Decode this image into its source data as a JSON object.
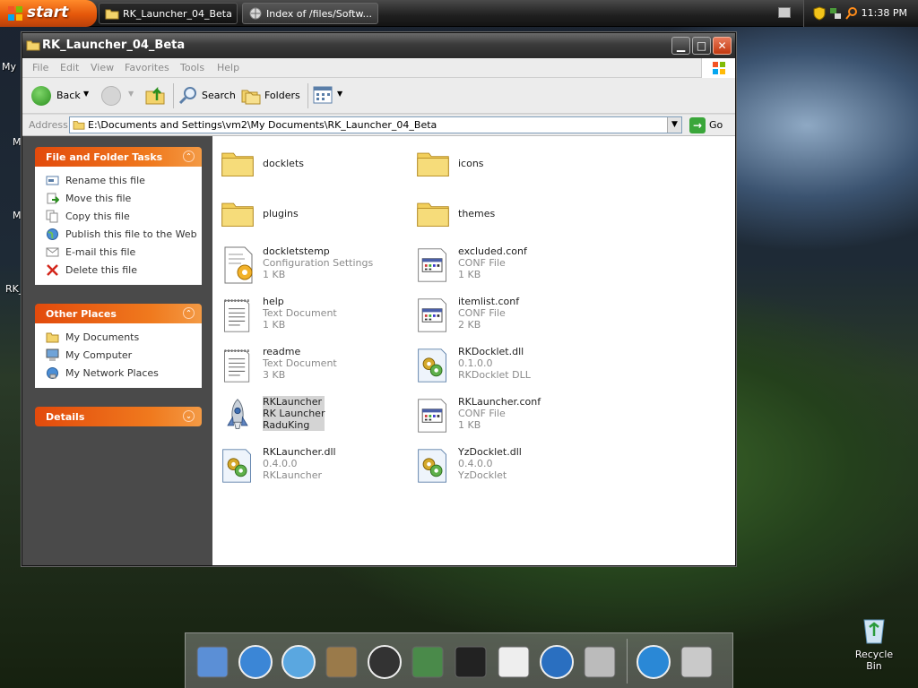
{
  "taskbar": {
    "start_label": "start",
    "tasks": [
      {
        "label": "RK_Launcher_04_Beta"
      },
      {
        "label": "Index of /files/Softw..."
      }
    ],
    "clock": "11:38 PM"
  },
  "desktop": {
    "icon_labels": [
      "My",
      "M",
      "M",
      "RK_"
    ],
    "recycle_bin": "Recycle Bin"
  },
  "window": {
    "title": "RK_Launcher_04_Beta",
    "menu": [
      "File",
      "Edit",
      "View",
      "Favorites",
      "Tools",
      "Help"
    ],
    "toolbar": {
      "back": "Back",
      "search": "Search",
      "folders": "Folders"
    },
    "address": {
      "label": "Address",
      "value": "E:\\Documents and Settings\\vm2\\My Documents\\RK_Launcher_04_Beta",
      "go": "Go"
    },
    "tasks_panel": {
      "title": "File and Folder Tasks",
      "items": [
        {
          "label": "Rename this file"
        },
        {
          "label": "Move this file"
        },
        {
          "label": "Copy this file"
        },
        {
          "label": "Publish this file to the Web"
        },
        {
          "label": "E-mail this file"
        },
        {
          "label": "Delete this file"
        }
      ]
    },
    "places_panel": {
      "title": "Other Places",
      "items": [
        {
          "label": "My Documents"
        },
        {
          "label": "My Computer"
        },
        {
          "label": "My Network Places"
        }
      ]
    },
    "details_panel": {
      "title": "Details"
    },
    "files": [
      {
        "name": "docklets",
        "line2": "",
        "line3": "",
        "icon": "folder-icon"
      },
      {
        "name": "icons",
        "line2": "",
        "line3": "",
        "icon": "folder-icon"
      },
      {
        "name": "plugins",
        "line2": "",
        "line3": "",
        "icon": "folder-icon"
      },
      {
        "name": "themes",
        "line2": "",
        "line3": "",
        "icon": "folder-icon"
      },
      {
        "name": "dockletstemp",
        "line2": "Configuration Settings",
        "line3": "1 KB",
        "icon": "config-settings-icon"
      },
      {
        "name": "excluded.conf",
        "line2": "CONF File",
        "line3": "1 KB",
        "icon": "conf-file-icon"
      },
      {
        "name": "help",
        "line2": "Text Document",
        "line3": "1 KB",
        "icon": "text-document-icon"
      },
      {
        "name": "itemlist.conf",
        "line2": "CONF File",
        "line3": "2 KB",
        "icon": "conf-file-icon"
      },
      {
        "name": "readme",
        "line2": "Text Document",
        "line3": "3 KB",
        "icon": "text-document-icon"
      },
      {
        "name": "RKDocklet.dll",
        "line2": "0.1.0.0",
        "line3": "RKDocklet DLL",
        "icon": "dll-icon"
      },
      {
        "name": "RKLauncher",
        "line2": "RK Launcher",
        "line3": "RaduKing",
        "icon": "rocket-icon",
        "selected": true
      },
      {
        "name": "RKLauncher.conf",
        "line2": "CONF File",
        "line3": "1 KB",
        "icon": "conf-file-icon"
      },
      {
        "name": "RKLauncher.dll",
        "line2": "0.4.0.0",
        "line3": "RKLauncher",
        "icon": "dll-icon"
      },
      {
        "name": "YzDocklet.dll",
        "line2": "0.4.0.0",
        "line3": "YzDocklet",
        "icon": "dll-icon"
      }
    ]
  },
  "dock": {
    "icons": [
      "finder-icon",
      "safari-icon",
      "ichat-icon",
      "address-book-icon",
      "itunes-icon",
      "iphoto-icon",
      "dvd-player-icon",
      "ical-icon",
      "quicktime-icon",
      "system-preferences-icon",
      "internet-explorer-icon",
      "trash-icon"
    ]
  },
  "colors": {
    "panel_header": "#e24a0c",
    "left_pane": "#4a4a4a",
    "selection": "#d4d4d4"
  }
}
